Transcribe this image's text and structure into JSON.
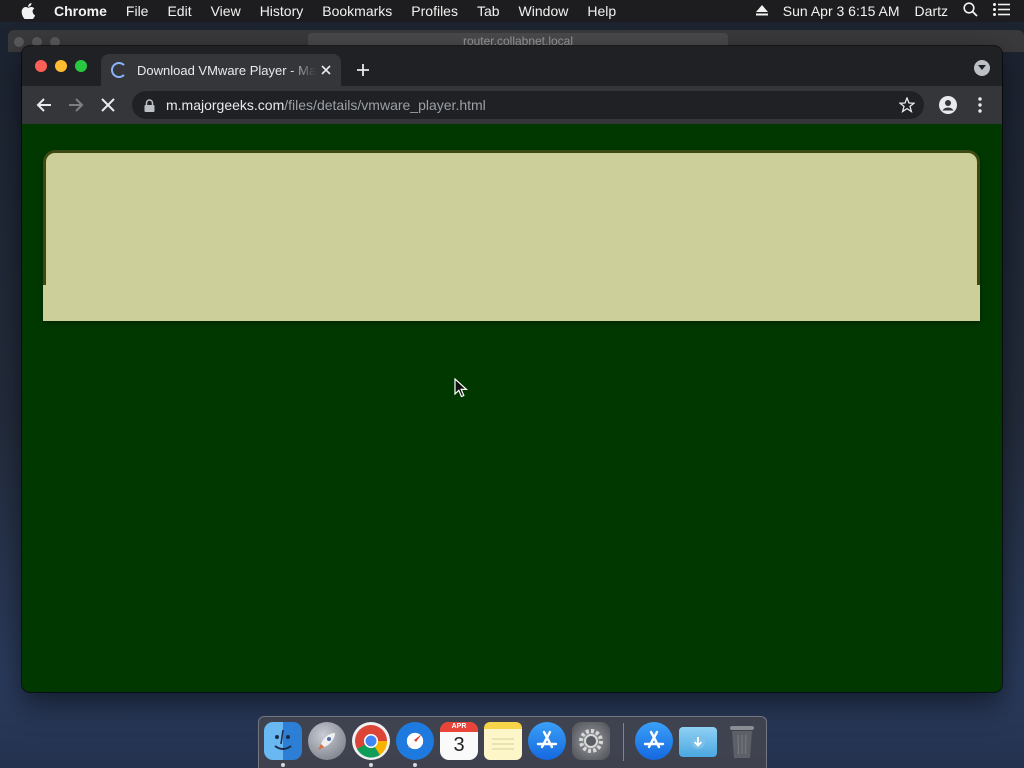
{
  "menubar": {
    "app": "Chrome",
    "items": [
      "File",
      "Edit",
      "View",
      "History",
      "Bookmarks",
      "Profiles",
      "Tab",
      "Window",
      "Help"
    ],
    "clock": "Sun Apr 3  6:15 AM",
    "user": "Dartz"
  },
  "background_window": {
    "url": "router.collabnet.local"
  },
  "browser": {
    "tab_title": "Download VMware Player - MajorGeeks",
    "url_host": "m.majorgeeks.com",
    "url_path": "/files/details/vmware_player.html",
    "loading": true
  },
  "page": {
    "background": "#003800",
    "panel_color": "#cdcf9b"
  },
  "dock": {
    "items": [
      "Finder",
      "Launchpad",
      "Google Chrome",
      "Safari",
      "Calendar",
      "Notes",
      "App Store",
      "System Preferences",
      "Applications",
      "Downloads",
      "Trash"
    ],
    "calendar_month": "APR",
    "calendar_day": "3"
  }
}
